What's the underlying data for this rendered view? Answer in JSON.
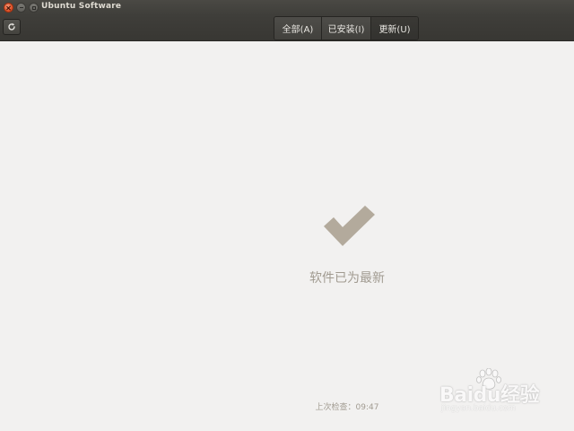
{
  "window": {
    "title": "Ubuntu Software"
  },
  "toolbar": {
    "refresh_icon": "refresh-icon",
    "tabs": [
      {
        "label": "全部(A)"
      },
      {
        "label": "已安装(I)"
      },
      {
        "label": "更新(U)"
      }
    ],
    "active_tab": "更新(U)"
  },
  "main": {
    "status_icon": "checkmark-icon",
    "status_text": "软件已为最新",
    "last_check_label": "上次检查：",
    "last_check_time": "09:47"
  },
  "watermark": {
    "brand": "Baidu经验",
    "url": "jingyan.baidu.com"
  },
  "colors": {
    "background": "#f2f1f0",
    "header": "#3f3e3a",
    "close_button": "#e2552b",
    "checkmark": "#b3aa9c",
    "muted_text": "#a19b91"
  }
}
